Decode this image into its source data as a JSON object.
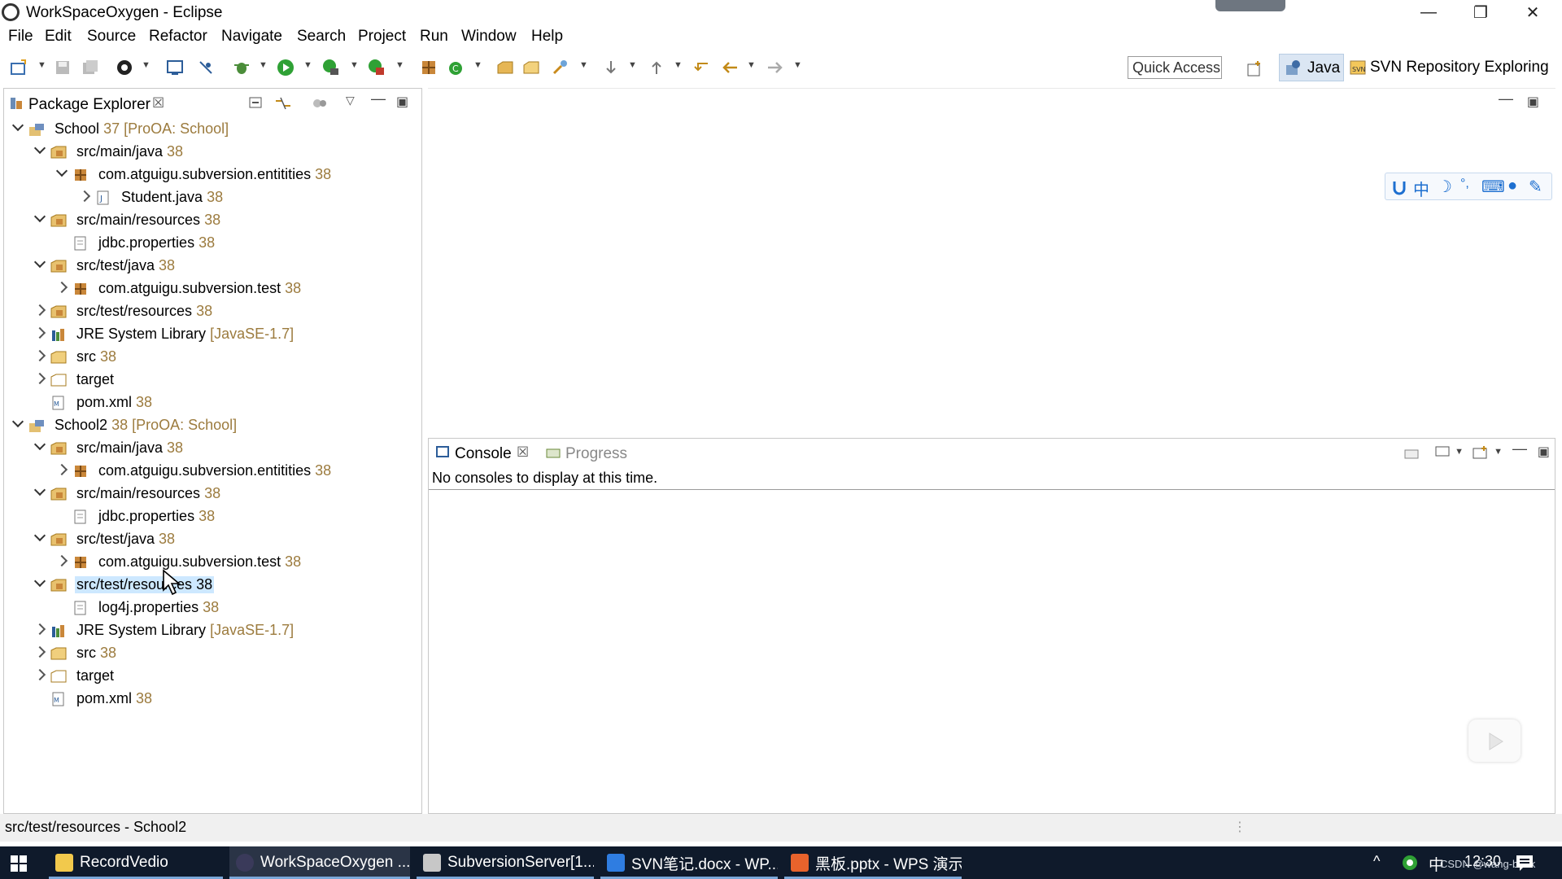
{
  "window": {
    "title": "WorkSpaceOxygen - Eclipse",
    "minimize": "—",
    "restore": "❐",
    "close": "✕"
  },
  "menu": [
    "File",
    "Edit",
    "Source",
    "Refactor",
    "Navigate",
    "Search",
    "Project",
    "Run",
    "Window",
    "Help"
  ],
  "toolbar": {
    "quick_access": "Quick Access",
    "perspectives": [
      "Java",
      "SVN Repository Exploring"
    ]
  },
  "package_explorer": {
    "tab_label": "Package Explorer",
    "tree": [
      {
        "text": "School",
        "deco": "37 [ProOA: School]"
      },
      {
        "text": "src/main/java",
        "deco": "38"
      },
      {
        "text": "com.atguigu.subversion.entitities",
        "deco": "38"
      },
      {
        "text": "Student.java",
        "deco": "38"
      },
      {
        "text": "src/main/resources",
        "deco": "38"
      },
      {
        "text": "jdbc.properties",
        "deco": "38"
      },
      {
        "text": "src/test/java",
        "deco": "38"
      },
      {
        "text": "com.atguigu.subversion.test",
        "deco": "38"
      },
      {
        "text": "src/test/resources",
        "deco": "38"
      },
      {
        "text": "JRE System Library",
        "deco": "[JavaSE-1.7]"
      },
      {
        "text": "src",
        "deco": "38"
      },
      {
        "text": "target",
        "deco": ""
      },
      {
        "text": "pom.xml",
        "deco": "38"
      },
      {
        "text": "School2",
        "deco": "38 [ProOA: School]"
      },
      {
        "text": "src/main/java",
        "deco": "38"
      },
      {
        "text": "com.atguigu.subversion.entitities",
        "deco": "38"
      },
      {
        "text": "src/main/resources",
        "deco": "38"
      },
      {
        "text": "jdbc.properties",
        "deco": "38"
      },
      {
        "text": "src/test/java",
        "deco": "38"
      },
      {
        "text": "com.atguigu.subversion.test",
        "deco": "38"
      },
      {
        "text": "src/test/resources",
        "deco": "38"
      },
      {
        "text": "log4j.properties",
        "deco": "38"
      },
      {
        "text": "JRE System Library",
        "deco": "[JavaSE-1.7]"
      },
      {
        "text": "src",
        "deco": "38"
      },
      {
        "text": "target",
        "deco": ""
      },
      {
        "text": "pom.xml",
        "deco": "38"
      }
    ]
  },
  "console": {
    "tabs": [
      "Console",
      "Progress"
    ],
    "message": "No consoles to display at this time."
  },
  "ime": {
    "mode": "中"
  },
  "status": {
    "text": "src/test/resources - School2"
  },
  "taskbar": {
    "items": [
      "RecordVedio",
      "WorkSpaceOxygen ...",
      "SubversionServer[1...",
      "SVN笔记.docx - WP...",
      "黑板.pptx - WPS 演示"
    ],
    "tray_ime": "中",
    "clock": "12:30",
    "watermark": "CSDN @wang-book"
  },
  "colors": {
    "selection": "#cde8ff",
    "decoration": "#9c7b3e",
    "taskbar": "#0f1a2b",
    "ime_blue": "#1d6fd0"
  }
}
